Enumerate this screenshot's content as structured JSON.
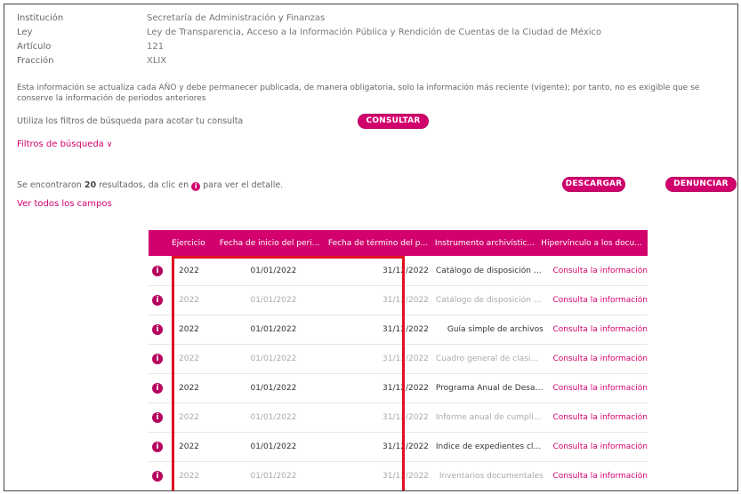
{
  "meta": {
    "institucion_label": "Institución",
    "institucion_value": "Secretaría de Administración y Finanzas",
    "ley_label": "Ley",
    "ley_value": "Ley de Transparencia, Acceso a la Información Pública y Rendición de Cuentas de la Ciudad de México",
    "articulo_label": "Artículo",
    "articulo_value": "121",
    "fraccion_label": "Fracción",
    "fraccion_value": "XLIX"
  },
  "notice": "Esta información se actualiza cada AÑO y debe permanecer publicada, de manera obligatoria, solo la información más reciente (vigente); por tanto, no es exigible que se conserve la información de periodos anteriores",
  "search": {
    "hint": "Utiliza los filtros de búsqueda para acotar tu consulta",
    "consultar_label": "CONSULTAR",
    "filters_label": "Filtros de búsqueda"
  },
  "results": {
    "prefix": "Se encontraron ",
    "count": "20",
    "suffix_before_icon": " resultados, da clic en ",
    "suffix_after_icon": " para ver el detalle.",
    "info_glyph": "i",
    "descargar_label": "DESCARGAR",
    "denunciar_label": "DENUNCIAR",
    "ver_todos_label": "Ver todos los campos"
  },
  "table": {
    "headers": [
      "Ejercicio",
      "Fecha de inicio del peri...",
      "Fecha de término del p...",
      "Instrumento archivístic...",
      "Hipervínculo a los docu..."
    ],
    "rows": [
      {
        "ejercicio": "2022",
        "inicio": "01/01/2022",
        "termino": "31/12/2022",
        "instrumento": "Catálogo de disposición doc...",
        "hipervinculo": "Consulta la información"
      },
      {
        "ejercicio": "2022",
        "inicio": "01/01/2022",
        "termino": "31/12/2022",
        "instrumento": "Catálogo de disposición doc...",
        "hipervinculo": "Consulta la información"
      },
      {
        "ejercicio": "2022",
        "inicio": "01/01/2022",
        "termino": "31/12/2022",
        "instrumento": "Guía simple de archivos",
        "hipervinculo": "Consulta la información"
      },
      {
        "ejercicio": "2022",
        "inicio": "01/01/2022",
        "termino": "31/12/2022",
        "instrumento": "Cuadro general de clasificac...",
        "hipervinculo": "Consulta la información"
      },
      {
        "ejercicio": "2022",
        "inicio": "01/01/2022",
        "termino": "31/12/2022",
        "instrumento": "Programa Anual de Desarro...",
        "hipervinculo": "Consulta la información"
      },
      {
        "ejercicio": "2022",
        "inicio": "01/01/2022",
        "termino": "31/12/2022",
        "instrumento": "Informe anual de cumplimi...",
        "hipervinculo": "Consulta la información"
      },
      {
        "ejercicio": "2022",
        "inicio": "01/01/2022",
        "termino": "31/12/2022",
        "instrumento": "Índice de expedientes clasifi...",
        "hipervinculo": "Consulta la información"
      },
      {
        "ejercicio": "2022",
        "inicio": "01/01/2022",
        "termino": "31/12/2022",
        "instrumento": "Inventarios documentales",
        "hipervinculo": "Consulta la información"
      }
    ]
  },
  "icons": {
    "info": "info-circle-icon",
    "chevron": "chevron-down-icon"
  },
  "colors": {
    "accent": "#d1006d",
    "highlight": "#e01020"
  }
}
